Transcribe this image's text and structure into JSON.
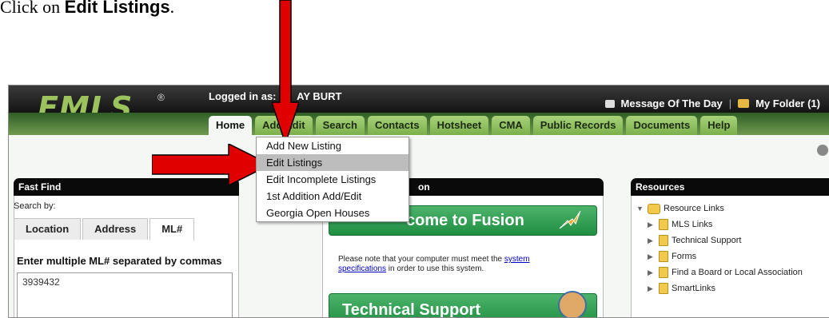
{
  "instruction": {
    "prefix": "Click on ",
    "target": "Edit Listings",
    "suffix": "."
  },
  "app": {
    "logo": "EMLS",
    "logo_reg": "®",
    "logged_in_prefix": "Logged in as:",
    "logged_in_user": "AY BURT",
    "topbar": {
      "message_label": "Message Of The Day",
      "separator": "|",
      "folder_label": "My Folder (1)"
    }
  },
  "nav_tabs": [
    "Home",
    "Add/Edit",
    "Search",
    "Contacts",
    "Hotsheet",
    "CMA",
    "Public Records",
    "Documents",
    "Help"
  ],
  "dropdown": {
    "items": [
      "Add New Listing",
      "Edit Listings",
      "Edit Incomplete Listings",
      "1st Addition Add/Edit",
      "Georgia Open Houses"
    ],
    "highlighted_index": 1
  },
  "fast_find": {
    "title": "Fast Find",
    "search_by": "Search by:",
    "tabs": [
      "Location",
      "Address",
      "ML#"
    ],
    "active_tab": "ML#",
    "ml_label": "Enter multiple ML# separated by commas",
    "ml_value": "3939432"
  },
  "center": {
    "title_fragment": "on",
    "welcome_text": "come to Fusion",
    "note_prefix": "Please note that your computer must meet the ",
    "note_link1": "system",
    "note_link2": "specifications",
    "note_suffix": " in order to use this system.",
    "tech_support": "Technical Support"
  },
  "resources": {
    "title": "Resources",
    "root": "Resource Links",
    "items": [
      "MLS Links",
      "Technical Support",
      "Forms",
      "Find a Board or Local Association",
      "SmartLinks"
    ]
  },
  "colors": {
    "arrow": "#e00000",
    "nav_green": "#6f9a4f",
    "tab_green": "#a9d27a",
    "banner_green": "#1f8f43"
  }
}
